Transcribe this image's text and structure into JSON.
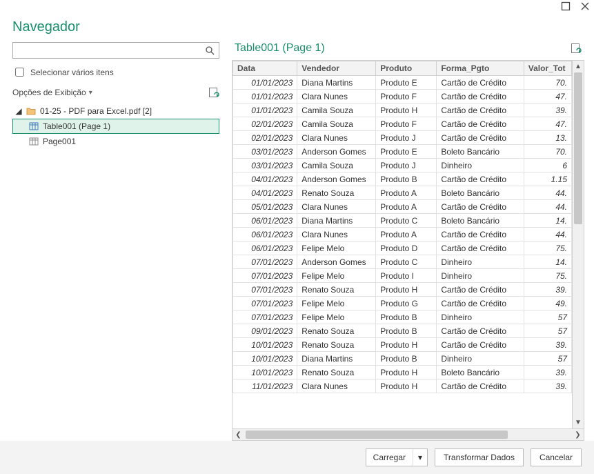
{
  "dialog": {
    "title": "Navegador",
    "search_placeholder": "",
    "multi_select_label": "Selecionar vários itens",
    "display_options_label": "Opções de Exibição"
  },
  "tree": {
    "root_label": "01-25 - PDF para Excel.pdf [2]",
    "items": [
      {
        "label": "Table001 (Page 1)",
        "selected": true
      },
      {
        "label": "Page001",
        "selected": false
      }
    ]
  },
  "preview": {
    "title": "Table001 (Page 1)",
    "columns": [
      "Data",
      "Vendedor",
      "Produto",
      "Forma_Pgto",
      "Valor_Tot"
    ],
    "rows": [
      [
        "01/01/2023",
        "Diana Martins",
        "Produto E",
        "Cartão de Crédito",
        "70."
      ],
      [
        "01/01/2023",
        "Clara Nunes",
        "Produto F",
        "Cartão de Crédito",
        "47."
      ],
      [
        "01/01/2023",
        "Camila Souza",
        "Produto H",
        "Cartão de Crédito",
        "39."
      ],
      [
        "02/01/2023",
        "Camila Souza",
        "Produto F",
        "Cartão de Crédito",
        "47."
      ],
      [
        "02/01/2023",
        "Clara Nunes",
        "Produto J",
        "Cartão de Crédito",
        "13."
      ],
      [
        "03/01/2023",
        "Anderson Gomes",
        "Produto E",
        "Boleto Bancário",
        "70."
      ],
      [
        "03/01/2023",
        "Camila Souza",
        "Produto J",
        "Dinheiro",
        "6"
      ],
      [
        "04/01/2023",
        "Anderson Gomes",
        "Produto B",
        "Cartão de Crédito",
        "1.15"
      ],
      [
        "04/01/2023",
        "Renato Souza",
        "Produto A",
        "Boleto Bancário",
        "44."
      ],
      [
        "05/01/2023",
        "Clara Nunes",
        "Produto A",
        "Cartão de Crédito",
        "44."
      ],
      [
        "06/01/2023",
        "Diana Martins",
        "Produto C",
        "Boleto Bancário",
        "14."
      ],
      [
        "06/01/2023",
        "Clara Nunes",
        "Produto A",
        "Cartão de Crédito",
        "44."
      ],
      [
        "06/01/2023",
        "Felipe Melo",
        "Produto D",
        "Cartão de Crédito",
        "75."
      ],
      [
        "07/01/2023",
        "Anderson Gomes",
        "Produto C",
        "Dinheiro",
        "14."
      ],
      [
        "07/01/2023",
        "Felipe Melo",
        "Produto I",
        "Dinheiro",
        "75."
      ],
      [
        "07/01/2023",
        "Renato Souza",
        "Produto H",
        "Cartão de Crédito",
        "39."
      ],
      [
        "07/01/2023",
        "Felipe Melo",
        "Produto G",
        "Cartão de Crédito",
        "49."
      ],
      [
        "07/01/2023",
        "Felipe Melo",
        "Produto B",
        "Dinheiro",
        "57"
      ],
      [
        "09/01/2023",
        "Renato Souza",
        "Produto B",
        "Cartão de Crédito",
        "57"
      ],
      [
        "10/01/2023",
        "Renato Souza",
        "Produto H",
        "Cartão de Crédito",
        "39."
      ],
      [
        "10/01/2023",
        "Diana Martins",
        "Produto B",
        "Dinheiro",
        "57"
      ],
      [
        "10/01/2023",
        "Renato Souza",
        "Produto H",
        "Boleto Bancário",
        "39."
      ],
      [
        "11/01/2023",
        "Clara Nunes",
        "Produto H",
        "Cartão de Crédito",
        "39."
      ]
    ]
  },
  "footer": {
    "load_label": "Carregar",
    "transform_label": "Transformar Dados",
    "cancel_label": "Cancelar"
  }
}
